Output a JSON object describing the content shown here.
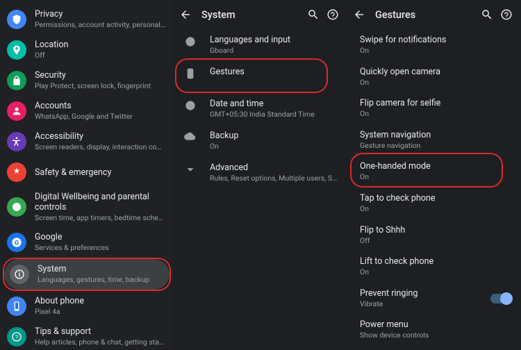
{
  "left": {
    "items": [
      {
        "title": "Privacy",
        "sub": "Permissions, account activity, personal data",
        "icon": "shield",
        "color": "c-blue"
      },
      {
        "title": "Location",
        "sub": "Off",
        "icon": "location",
        "color": "c-teal"
      },
      {
        "title": "Security",
        "sub": "Play Protect, screen lock, fingerprint",
        "icon": "lock",
        "color": "c-green"
      },
      {
        "title": "Accounts",
        "sub": "WhatsApp, Google and Twitter",
        "icon": "account",
        "color": "c-pink"
      },
      {
        "title": "Accessibility",
        "sub": "Screen readers, display, interaction controls",
        "icon": "accessibility",
        "color": "c-purple"
      },
      {
        "title": "Safety & emergency",
        "sub": "",
        "icon": "safety",
        "color": "c-red"
      },
      {
        "title": "Digital Wellbeing and parental controls",
        "sub": "Screen time, app timers, bedtime schedules",
        "icon": "wellbeing",
        "color": "c-green2"
      },
      {
        "title": "Google",
        "sub": "Services & preferences",
        "icon": "google",
        "color": "c-blue2"
      },
      {
        "title": "System",
        "sub": "Languages, gestures, time, backup",
        "icon": "info",
        "color": "c-grey",
        "selected": true
      },
      {
        "title": "About phone",
        "sub": "Pixel 4a",
        "icon": "phone",
        "color": "c-blue"
      },
      {
        "title": "Tips & support",
        "sub": "Help articles, phone & chat, getting started",
        "icon": "help",
        "color": "c-teal2"
      }
    ]
  },
  "middle": {
    "header": "System",
    "items": [
      {
        "title": "Languages and input",
        "sub": "Gboard",
        "icon": "globe"
      },
      {
        "title": "Gestures",
        "sub": "",
        "icon": "gesture",
        "highlight": true
      },
      {
        "title": "Date and time",
        "sub": "GMT+05:30 India Standard Time",
        "icon": "clock"
      },
      {
        "title": "Backup",
        "sub": "On",
        "icon": "backup"
      },
      {
        "title": "Advanced",
        "sub": "Rules, Reset options, Multiple users, System up…",
        "icon": "expand"
      }
    ]
  },
  "right": {
    "header": "Gestures",
    "items": [
      {
        "title": "Swipe for notifications",
        "sub": "On"
      },
      {
        "title": "Quickly open camera",
        "sub": "On"
      },
      {
        "title": "Flip camera for selfie",
        "sub": "On"
      },
      {
        "title": "System navigation",
        "sub": "Gesture navigation"
      },
      {
        "title": "One-handed mode",
        "sub": "On",
        "highlight": true
      },
      {
        "title": "Tap to check phone",
        "sub": "On"
      },
      {
        "title": "Flip to Shhh",
        "sub": "Off"
      },
      {
        "title": "Lift to check phone",
        "sub": "On"
      },
      {
        "title": "Prevent ringing",
        "sub": "Vibrate",
        "toggle": true
      },
      {
        "title": "Power menu",
        "sub": "Show device controls"
      }
    ]
  },
  "highlight_color": "#d92b2b"
}
